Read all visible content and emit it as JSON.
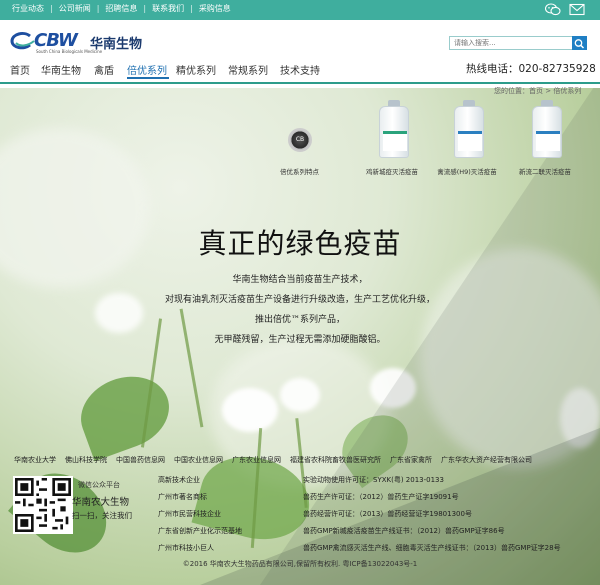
{
  "topbar": {
    "links": [
      "行业动态",
      "公司新闻",
      "招聘信息",
      "联系我们",
      "采购信息"
    ]
  },
  "logo": {
    "mark": "CBW",
    "name": "华南生物",
    "tagline": "South China Biologicals Medicine"
  },
  "search": {
    "placeholder": "请输入搜索..."
  },
  "nav": {
    "items": [
      "首页",
      "华南生物",
      "禽盾",
      "倍优系列",
      "精优系列",
      "常规系列",
      "技术支持"
    ],
    "active_index": 3
  },
  "hotline": "热线电话：020-82735928",
  "breadcrumb": "您的位置：首页 > 倍优系列",
  "products": {
    "seal_text": "CB",
    "seal_caption": "倍优系列特点",
    "items": [
      "鸡新城疫灭活疫苗",
      "禽流感(H9)灭活疫苗",
      "新流二联灭活疫苗"
    ]
  },
  "hero": {
    "title": "真正的绿色疫苗",
    "lines": [
      "华南生物结合当前疫苗生产技术，",
      "对现有油乳剂灭活疫苗生产设备进行升级改造，生产工艺优化升级，",
      "推出倍优™系列产品，",
      "无甲醛残留，生产过程无需添加硬脂酸铝。"
    ]
  },
  "footer": {
    "friend_links": [
      "华南农业大学",
      "佛山科技学院",
      "中国兽药信息网",
      "中国农业信息网",
      "广东农业信息网",
      "福建省农科院畜牧兽医研究所",
      "广东省家禽所",
      "广东华农大资产经营有限公司"
    ],
    "wechat_label": "微信公众平台",
    "brand": "华南农大生物",
    "follow": "扫一扫，关注我们",
    "honors": [
      "高新技术企业",
      "广州市著名商标",
      "广州市民营科技企业",
      "广东省创新产业化示范基地",
      "广州市科技小巨人"
    ],
    "licenses": [
      "实验动物使用许可证：SYXK(粤) 2013-0133",
      "兽药生产许可证：（2012）兽药生产证字19091号",
      "兽药经营许可证：（2013）兽药经营证字19801300号",
      "兽药GMP新城疫活疫苗生产线证书：（2012）兽药GMP证字86号",
      "兽药GMP禽流感灭活生产线、细胞毒灭活生产线证书：（2013）兽药GMP证字28号"
    ],
    "copyright": "©2016 华南农大生物药品有限公司,保留所有权利. 粤ICP备13022043号-1"
  },
  "colors": {
    "topbar": "#3fae9e",
    "nav_active": "#1e6fb0",
    "logo_blue": "#1e4fa0"
  },
  "icons": {
    "wechat": "wechat-icon",
    "mail": "mail-icon",
    "search": "search-icon"
  }
}
